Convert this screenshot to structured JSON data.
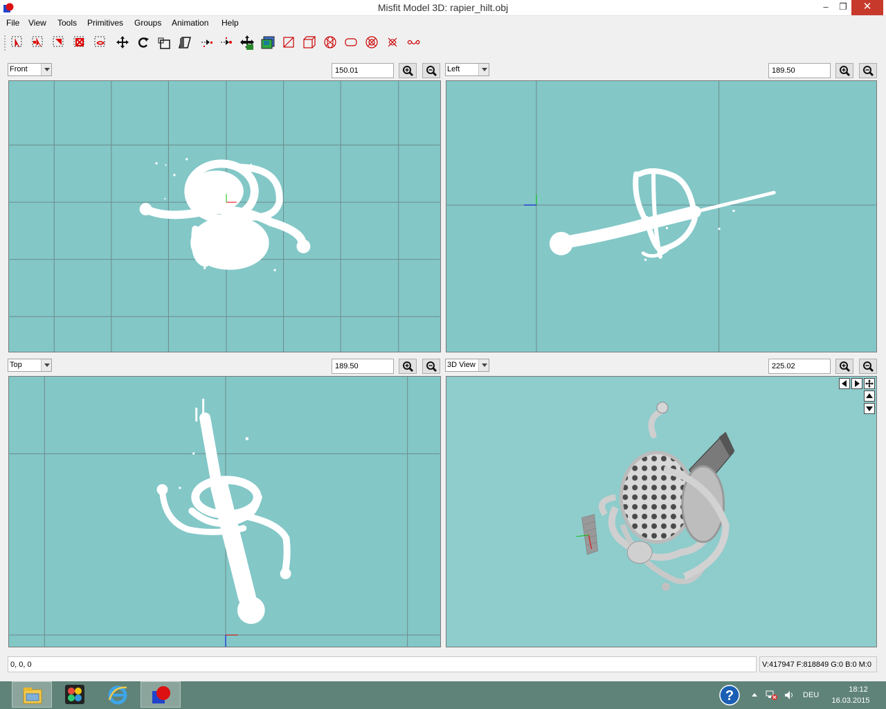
{
  "window": {
    "title": "Misfit Model 3D: rapier_hilt.obj",
    "min_glyph": "–",
    "max_glyph": "❐",
    "close_glyph": "✕"
  },
  "menu": [
    "File",
    "View",
    "Tools",
    "Primitives",
    "Groups",
    "Animation",
    "Help"
  ],
  "toolbar": [
    "select-vertices-tool-icon",
    "select-faces-tool-icon",
    "select-connected-tool-icon",
    "select-groups-tool-icon",
    "select-bone-joints-tool-icon",
    "move-tool-icon",
    "rotate-tool-icon",
    "scale-tool-icon",
    "shear-tool-icon",
    "create-vertex-tool-icon",
    "attach-point-tool-icon",
    "bone-joint-tool-icon",
    "background-tool-icon",
    "create-rectangle-tool-icon",
    "create-cube-tool-icon",
    "create-ellipsoid-tool-icon",
    "create-cylinder-tool-icon",
    "create-torus-tool-icon",
    "create-polygon-tool-icon",
    "projection-tool-icon"
  ],
  "viewports": [
    {
      "view": "Front",
      "zoom": "150.01"
    },
    {
      "view": "Left",
      "zoom": "189.50"
    },
    {
      "view": "Top",
      "zoom": "189.50"
    },
    {
      "view": "3D View",
      "zoom": "225.02"
    }
  ],
  "status": {
    "coords": "0, 0, 0",
    "stats": "V:417947 F:818849 G:0 B:0 M:0"
  },
  "taskbar": {
    "apps": [
      "file-explorer-icon",
      "colorful-app-icon",
      "internet-explorer-icon",
      "misfit-model-3d-icon"
    ],
    "language": "DEU",
    "time": "18:12",
    "date": "16.03.2015"
  },
  "colors": {
    "viewport_bg": "#83c7c7",
    "grid": "#6e8a8a",
    "close_button": "#c7392a",
    "taskbar": "#5f8378"
  }
}
